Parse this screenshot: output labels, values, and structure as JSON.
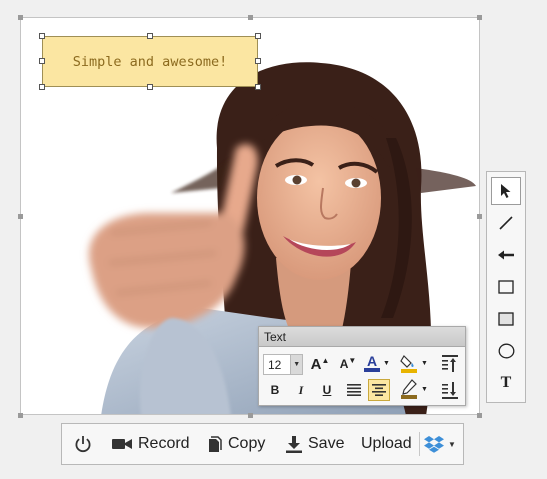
{
  "callout": {
    "text": "Simple and awesome!"
  },
  "text_panel": {
    "title": "Text",
    "font_size": "12",
    "bold_label": "B",
    "italic_label": "I",
    "underline_label": "U",
    "grow_label": "A",
    "shrink_label": "A",
    "color_label": "A",
    "font_color": "#2a3f9a",
    "highlight_color": "#e8b400"
  },
  "tools": [
    {
      "name": "select-tool",
      "icon": "cursor-arrow-icon",
      "selected": true
    },
    {
      "name": "line-tool",
      "icon": "line-icon"
    },
    {
      "name": "arrow-tool",
      "icon": "arrow-left-icon"
    },
    {
      "name": "rectangle-tool",
      "icon": "rectangle-outline-icon"
    },
    {
      "name": "filled-rectangle-tool",
      "icon": "rectangle-filled-icon"
    },
    {
      "name": "ellipse-tool",
      "icon": "ellipse-icon"
    },
    {
      "name": "text-tool",
      "icon": "text-t-icon",
      "label": "T"
    }
  ],
  "actions": {
    "record": "Record",
    "copy": "Copy",
    "save": "Save",
    "upload": "Upload"
  },
  "colors": {
    "accent": "#fbe6a2",
    "dropbox_blue": "#3d8fd8"
  }
}
